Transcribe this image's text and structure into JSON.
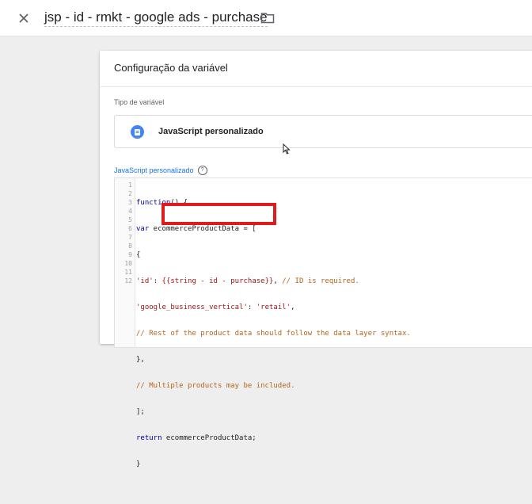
{
  "header": {
    "title": "jsp - id - rmkt - google ads - purchase",
    "close_icon": "close-icon",
    "folder_icon": "folder-icon"
  },
  "card": {
    "title": "Configuração da variável",
    "type_label": "Tipo de variável",
    "type_name": "JavaScript personalizado",
    "code_label": "JavaScript personalizado"
  },
  "code": {
    "line_numbers": [
      "1",
      "2",
      "3",
      "4",
      "5",
      "6",
      "7",
      "8",
      "9",
      "10",
      "11",
      "12"
    ],
    "lines": [
      "function() {",
      "var ecommerceProductData = [",
      "{",
      "'id': {{string - id - purchase}}, // ID is required.",
      "'google_business_vertical': 'retail',",
      "// Rest of the product data should follow the data layer syntax.",
      "},",
      "// Multiple products may be included.",
      "];",
      "return ecommerceProductData;",
      "}",
      ""
    ]
  },
  "colors": {
    "accent": "#1a73e8",
    "highlight": "#e01b1b",
    "type_icon": "#4285f4"
  }
}
